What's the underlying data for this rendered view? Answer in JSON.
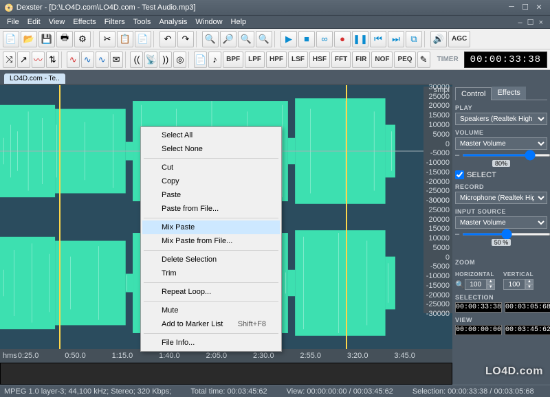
{
  "title": "Dexster - [D:\\LO4D.com\\LO4D.com - Test Audio.mp3]",
  "menu": [
    "File",
    "Edit",
    "View",
    "Effects",
    "Filters",
    "Tools",
    "Analysis",
    "Window",
    "Help"
  ],
  "toolbar1": {
    "icons": [
      "new",
      "open",
      "save",
      "print",
      "settings",
      "cut",
      "copy",
      "paste",
      "undo",
      "redo",
      "zoom-in",
      "zoom-out",
      "zoom-fit",
      "zoom-sel",
      "play",
      "stop",
      "loop",
      "record",
      "pause",
      "skip-back",
      "skip-fwd",
      "marker",
      "speaker",
      "agc"
    ]
  },
  "toolbar2": {
    "icons": [
      "shuffle",
      "fade",
      "gain",
      "mix",
      "wave1",
      "wave2",
      "wave3",
      "mail",
      "radio-left",
      "radio",
      "radio-right",
      "ripple",
      "doc",
      "note",
      "bpf",
      "lpf",
      "hpf",
      "lsf",
      "hsf",
      "fft",
      "fir",
      "nof",
      "peq",
      "pencil"
    ]
  },
  "timer_label": "TIMER",
  "timer_value": "00:00:33:38",
  "tab_label": "LO4D.com - Te..",
  "amp_label": "smpl",
  "amp_ticks": [
    "30000",
    "25000",
    "20000",
    "15000",
    "10000",
    "5000",
    "0",
    "-5000",
    "-10000",
    "-15000",
    "-20000",
    "-25000",
    "-30000"
  ],
  "time_label": "hms",
  "time_ticks": [
    "0:25.0",
    "0:50.0",
    "1:15.0",
    "1:40.0",
    "2:05.0",
    "2:30.0",
    "2:55.0",
    "3:20.0",
    "3:45.0"
  ],
  "context_menu": {
    "items": [
      {
        "label": "Select All"
      },
      {
        "label": "Select None"
      },
      {
        "divider": true
      },
      {
        "label": "Cut"
      },
      {
        "label": "Copy"
      },
      {
        "label": "Paste"
      },
      {
        "label": "Paste from File..."
      },
      {
        "divider": true
      },
      {
        "label": "Mix Paste",
        "highlight": true
      },
      {
        "label": "Mix Paste from File..."
      },
      {
        "divider": true
      },
      {
        "label": "Delete Selection"
      },
      {
        "label": "Trim"
      },
      {
        "divider": true
      },
      {
        "label": "Repeat Loop..."
      },
      {
        "divider": true
      },
      {
        "label": "Mute"
      },
      {
        "label": "Add to Marker List",
        "shortcut": "Shift+F8"
      },
      {
        "divider": true
      },
      {
        "label": "File Info..."
      }
    ]
  },
  "side": {
    "tabs": [
      "Control",
      "Effects"
    ],
    "play_label": "PLAY",
    "play_device": "Speakers (Realtek High Def",
    "volume_label": "VOLUME",
    "volume_source": "Master Volume",
    "volume_pct": "80%",
    "select_label": "SELECT",
    "record_label": "RECORD",
    "record_device": "Microphone (Realtek High D",
    "input_label": "INPUT SOURCE",
    "input_source": "Master Volume",
    "input_pct": "50 %",
    "zoom_label": "ZOOM",
    "zoom_h_label": "HORIZONTAL",
    "zoom_v_label": "VERTICAL",
    "zoom_h": "100",
    "zoom_v": "100",
    "selection_label": "SELECTION",
    "sel_start": "00:00:33:38",
    "sel_end": "00:03:05:68",
    "view_label": "VIEW",
    "view_start": "00:00:00:00",
    "view_end": "00:03:45:62"
  },
  "status": {
    "format": "MPEG 1.0 layer-3; 44,100 kHz; Stereo; 320 Kbps;",
    "total": "Total time: 00:03:45:62",
    "view": "View: 00:00:00:00 / 00:03:45:62",
    "selection": "Selection: 00:00:33:38 / 00:03:05:68"
  },
  "watermark": "LO4D.com"
}
